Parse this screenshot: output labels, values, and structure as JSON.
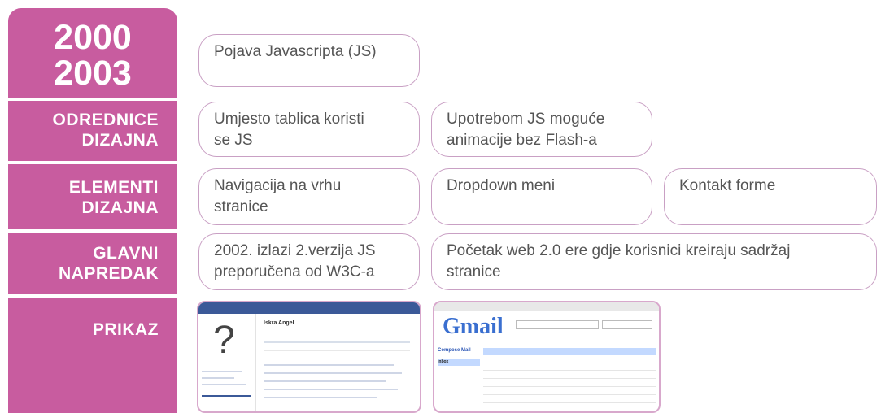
{
  "sidebar": {
    "year_start": "2000",
    "year_end": "2003",
    "odrednice_1": "ODREDNICE",
    "odrednice_2": "DIZAJNA",
    "elementi_1": "ELEMENTI",
    "elementi_2": "DIZAJNA",
    "glavni_1": "GLAVNI",
    "glavni_2": "NAPREDAK",
    "prikaz": "PRIKAZ"
  },
  "row_year": {
    "box1": "Pojava Javascripta (JS)"
  },
  "row_odrednice": {
    "box1_line1": "Umjesto tablica koristi",
    "box1_line2": "se JS",
    "box2_line1": "Upotrebom JS moguće",
    "box2_line2": "animacije bez Flash-a"
  },
  "row_elementi": {
    "box1_line1": "Navigacija na vrhu",
    "box1_line2": "stranice",
    "box2": "Dropdown meni",
    "box3": "Kontakt forme"
  },
  "row_glavni": {
    "box1_line1": "2002. izlazi 2.verzija JS",
    "box1_line2": "preporučena od W3C-a",
    "box2_line1": "Početak web 2.0 ere gdje korisnici kreiraju sadržaj",
    "box2_line2": "stranice"
  },
  "screenshots": {
    "facebook_name": "Iskra Angel",
    "gmail_logo": "Gmail",
    "gmail_compose": "Compose Mail",
    "gmail_inbox": "Inbox"
  },
  "colors": {
    "accent": "#c85c9f",
    "box_border": "#c9a0c4",
    "text": "#555555"
  }
}
